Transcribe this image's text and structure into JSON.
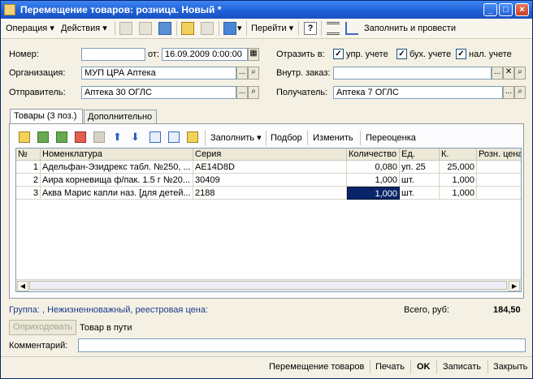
{
  "window": {
    "title": "Перемещение товаров: розница. Новый *",
    "controls": [
      "_",
      "□",
      "×"
    ]
  },
  "toolbar": {
    "operation_label": "Операция",
    "actions_label": "Действия",
    "goto_label": "Перейти",
    "help_label": "?",
    "fill_and_post_label": "Заполнить и провести"
  },
  "form": {
    "number_label": "Номер:",
    "number_value": "",
    "from_label": "от:",
    "date_value": "16.09.2009  0:00:00",
    "reflect_label": "Отразить в:",
    "mgmt_label": "упр. учете",
    "acct_label": "бух. учете",
    "tax_label": "нал. учете",
    "org_label": "Организация:",
    "org_value": "МУП ЦРА Аптека",
    "internal_order_label": "Внутр. заказ:",
    "internal_order_value": "",
    "sender_label": "Отправитель:",
    "sender_value": "Аптека 30 ОГЛС",
    "receiver_label": "Получатель:",
    "receiver_value": "Аптека 7 ОГЛС",
    "btn_dots": "...",
    "btn_x": "✕"
  },
  "tabs": [
    {
      "label": "Товары (3 поз.)"
    },
    {
      "label": "Дополнительно"
    }
  ],
  "grid_toolbar": {
    "fill_label": "Заполнить",
    "select_label": "Подбор",
    "change_label": "Изменить",
    "reprice_label": "Переоценка"
  },
  "table": {
    "headers": [
      "№",
      "Номенклатура",
      "Серия",
      "Количество",
      "Ед.",
      "К.",
      "Розн. цена"
    ],
    "rows": [
      {
        "n": "1",
        "name": "Адельфан-Эзидрекс табл. №250, ...",
        "series": "AE14D8D",
        "qty": "0,080",
        "unit": "уп. 25",
        "k": "25,000",
        "price": ""
      },
      {
        "n": "2",
        "name": "Аира корневища ф/пак. 1.5 г №20...",
        "series": "30409",
        "qty": "1,000",
        "unit": "шт.",
        "k": "1,000",
        "price": ""
      },
      {
        "n": "3",
        "name": "Аква Марис капли наз. [для детей...",
        "series": "2188",
        "qty": "1,000",
        "unit": "шт.",
        "k": "1,000",
        "price": ""
      }
    ]
  },
  "footer": {
    "group_text": "Группа: , Нежизненноважный, реестровая цена:",
    "total_label": "Всего, руб:",
    "total_value": "184,50",
    "receive_btn": "Оприходовать",
    "in_transit_label": "Товар в пути",
    "comment_label": "Комментарий:",
    "comment_value": ""
  },
  "bottom_buttons": {
    "transfer_label": "Перемещение товаров",
    "print_label": "Печать",
    "ok_label": "OK",
    "save_label": "Записать",
    "close_label": "Закрыть"
  }
}
